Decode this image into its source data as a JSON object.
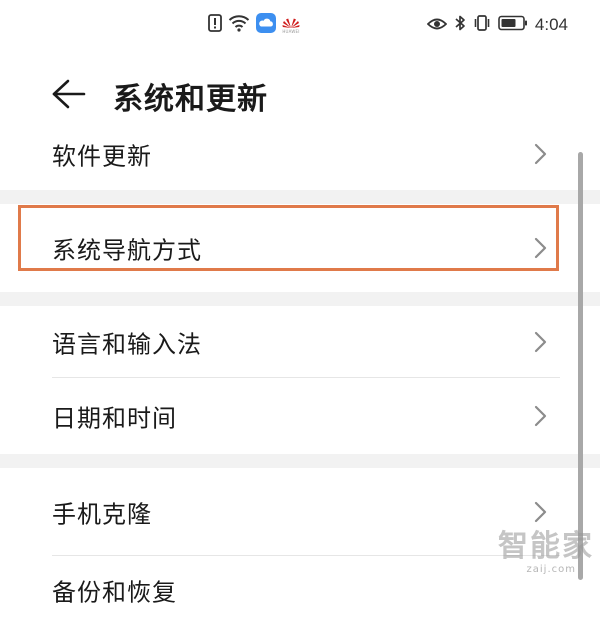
{
  "status_bar": {
    "time": "4:04",
    "carrier_logo_text": "HUAWEI",
    "icons": [
      "alert-icon",
      "wifi-icon",
      "cloud-icon",
      "huawei-logo-icon",
      "eye-icon",
      "bluetooth-icon",
      "vibrate-icon",
      "battery-icon"
    ]
  },
  "header": {
    "title": "系统和更新",
    "back_icon": "back-arrow-icon"
  },
  "list": {
    "groups": [
      {
        "items": [
          {
            "label": "软件更新"
          }
        ]
      },
      {
        "items": [
          {
            "label": "系统导航方式",
            "highlighted": true
          }
        ]
      },
      {
        "items": [
          {
            "label": "语言和输入法"
          },
          {
            "label": "日期和时间"
          }
        ]
      },
      {
        "items": [
          {
            "label": "手机克隆"
          },
          {
            "label": "备份和恢复"
          }
        ]
      }
    ]
  },
  "colors": {
    "highlight": "#e07a4a",
    "group_gap": "#f2f2f2",
    "chevron": "#8c8c8c"
  },
  "watermark": {
    "text": "智能家",
    "subtext": "zaij.com"
  }
}
